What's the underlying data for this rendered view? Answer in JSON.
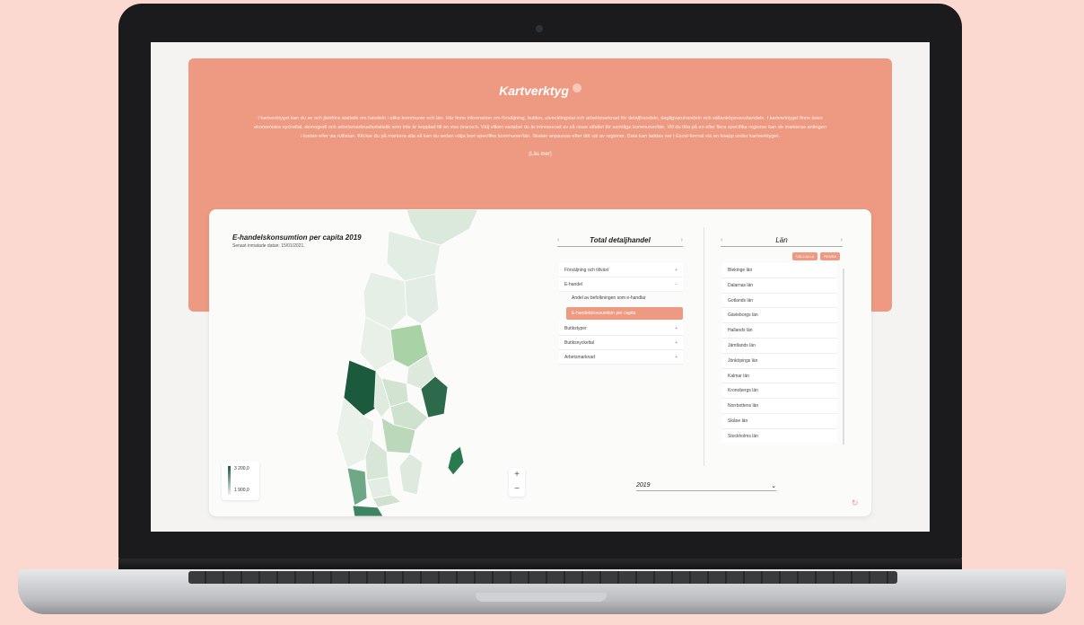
{
  "hero": {
    "title": "Kartverktyg",
    "description": "I kartverktyget kan du se och jämföra statistik om handeln i olika kommuner och län. Här finns information om försäljning, butiker, utvecklingstal och arbetsmarknad för detaljhandeln, dagligvaruhandeln och sällanköpsvaruhandeln. I kartverktyget finns även ekonomiska nyckeltal, demografi och arbetsmarknadsstatistik som inte är kopplad till en viss bransch. Välj vilken variabel du är intresserad av så visas utfallet för samtliga kommuner/län. Vill du titta på en eller flera specifika regioner kan de markeras antingen i kartan eller via rullistan. Klickar du på markera alla så kan du sedan välja bort specifika kommuner/län. Skalan anpassas efter ditt val av regioner. Data kan laddas ner i Excel-format via en knapp under kartverktyget.",
    "read_more": "(Läs mer)"
  },
  "map": {
    "title": "E-handelskonsumtion per capita 2019",
    "subtitle": "Senast inmatade datan: 15/01/2021,",
    "legend_max": "3 200,0",
    "legend_min": "1 900,0",
    "zoom_in": "+",
    "zoom_out": "−"
  },
  "variables": {
    "title": "Total detaljhandel",
    "prev": "‹",
    "next": "›",
    "items": [
      {
        "label": "Försäljning och tillväxt",
        "sign": "+"
      },
      {
        "label": "E-handel",
        "sign": "−"
      }
    ],
    "sub_items": [
      "Andel av befolkningen som e-handlar"
    ],
    "active_sub": "E-handelskonsumtion per capita",
    "items_after": [
      {
        "label": "Butikstyper",
        "sign": "+"
      },
      {
        "label": "Butiksnyckeltal",
        "sign": "+"
      },
      {
        "label": "Arbetsmarknad",
        "sign": "+"
      }
    ]
  },
  "lan": {
    "title": "Län",
    "prev": "‹",
    "next": "›",
    "select_all": "VÄLJ ALLA",
    "reset": "RENSA",
    "items": [
      "Blekinge län",
      "Dalarnas län",
      "Gotlands län",
      "Gävleborgs län",
      "Hallands län",
      "Jämtlands län",
      "Jönköpings län",
      "Kalmar län",
      "Kronobergs län",
      "Norrbottens län",
      "Skåne län",
      "Stockholms län"
    ]
  },
  "year": {
    "value": "2019",
    "caret": "⌄"
  },
  "colors": {
    "accent": "#ee9a82",
    "map_dark": "#1c5a3e",
    "map_light": "#e9f2ea"
  }
}
